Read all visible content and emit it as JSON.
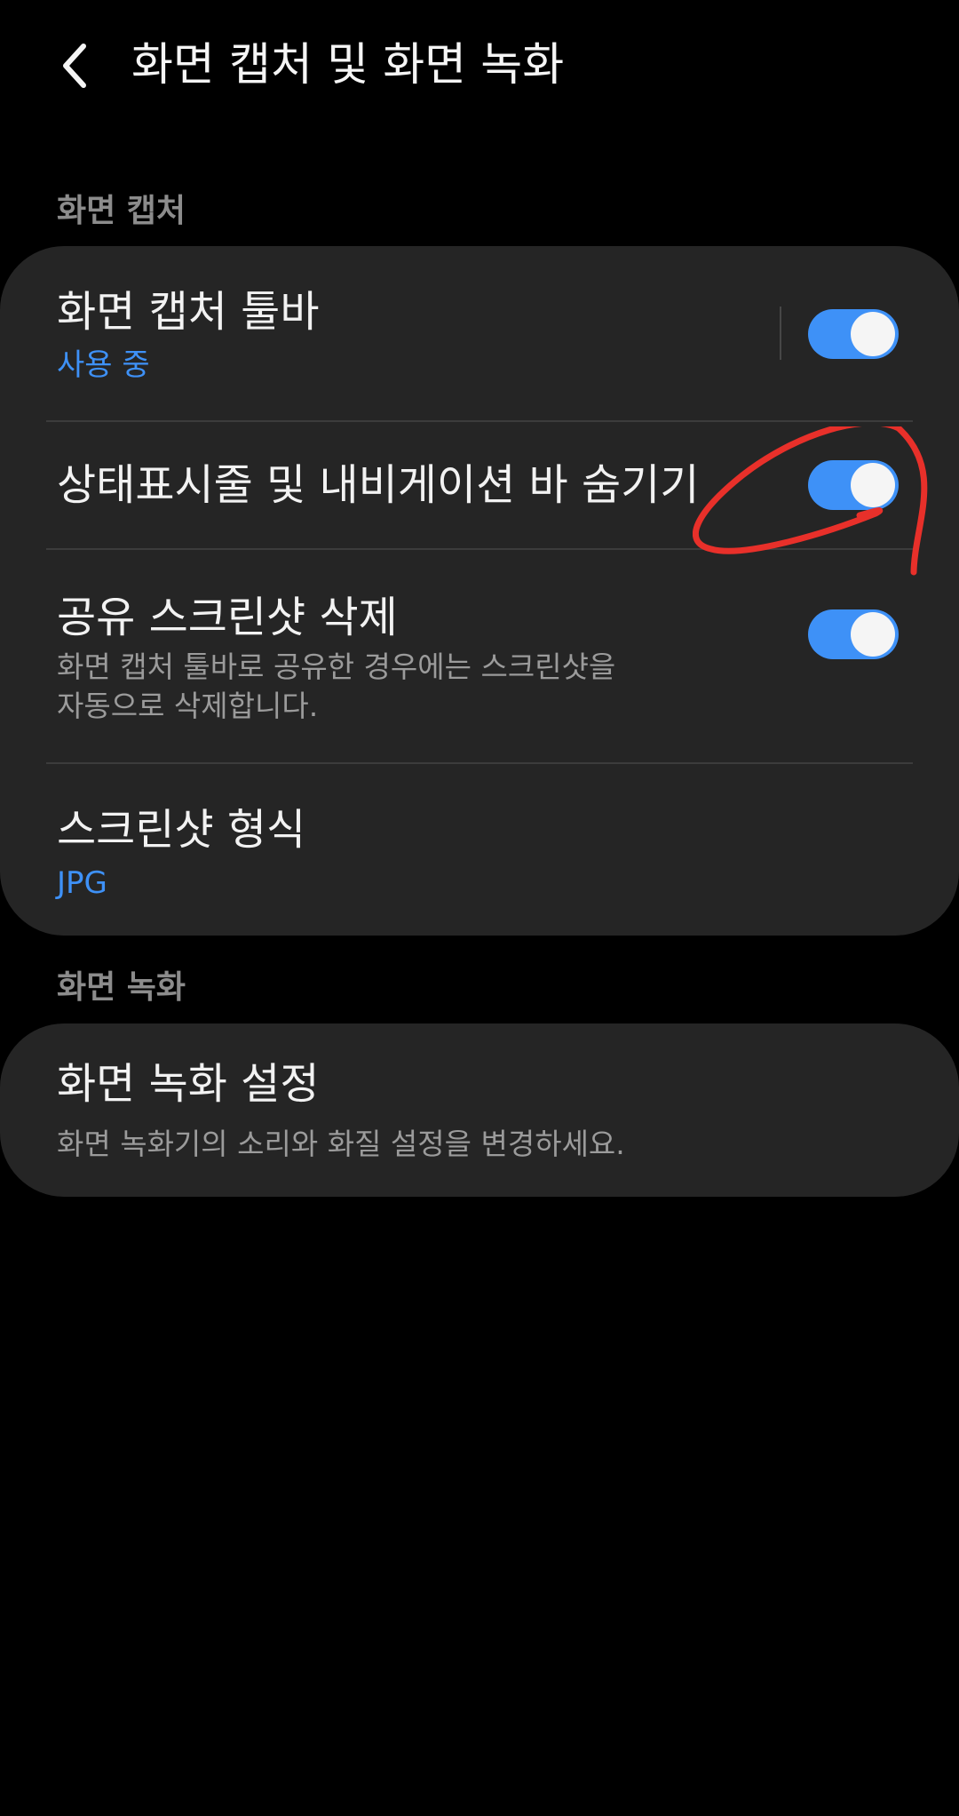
{
  "header": {
    "title": "화면 캡처 및 화면 녹화",
    "back_icon": "chevron-left-icon"
  },
  "sections": {
    "capture": {
      "label": "화면 캡처",
      "toolbar": {
        "title": "화면 캡처 툴바",
        "status": "사용 중",
        "enabled": true
      },
      "hide_bars": {
        "title": "상태표시줄 및 내비게이션 바 숨기기",
        "enabled": true
      },
      "delete_shared": {
        "title": "공유 스크린샷 삭제",
        "desc_line1": "화면 캡처 툴바로 공유한 경우에는 스크린샷을",
        "desc_line2": "자동으로 삭제합니다.",
        "enabled": true
      },
      "format": {
        "title": "스크린샷 형식",
        "value": "JPG"
      }
    },
    "recording": {
      "label": "화면 녹화",
      "settings": {
        "title": "화면 녹화 설정",
        "desc": "화면 녹화기의 소리와 화질 설정을 변경하세요."
      }
    }
  },
  "colors": {
    "background": "#000000",
    "card": "#252525",
    "accent": "#3e91f7",
    "annotation": "#e8302a"
  }
}
